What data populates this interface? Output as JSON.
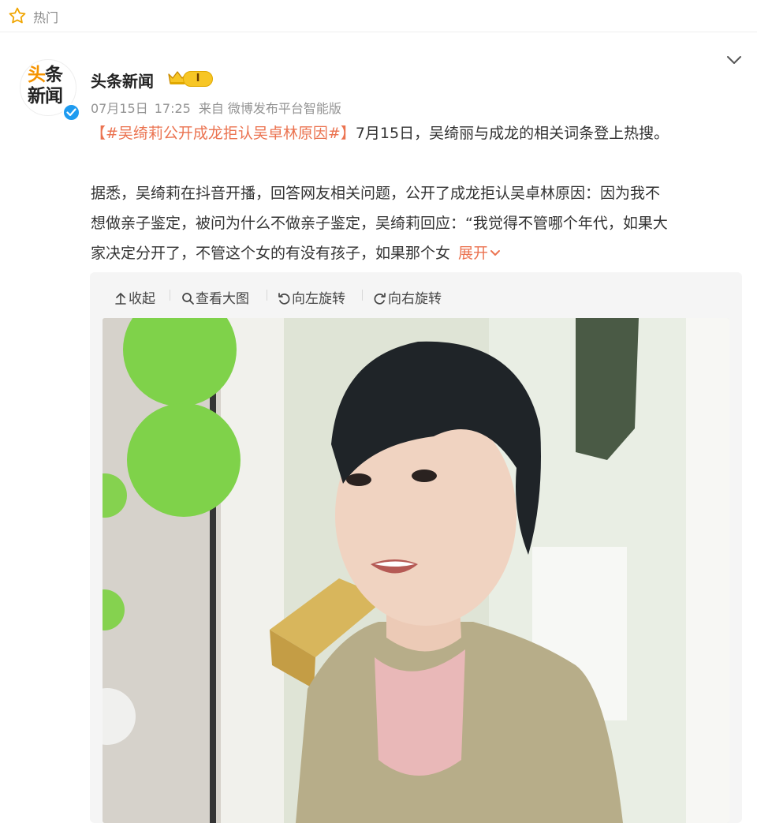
{
  "topbar": {
    "label": "热门",
    "icon": "star-icon"
  },
  "post": {
    "author": "头条新闻",
    "avatar_line1": [
      "头",
      "条"
    ],
    "avatar_line2": "新闻",
    "level": "I",
    "date": "07月15日",
    "time": "17:25",
    "source": "来自 微博发布平台智能版",
    "hashtag": "【#吴绮莉公开成龙拒认吴卓林原因#】",
    "intro": "7月15日，吴绮丽与成龙的相关词条登上热搜。",
    "body_lines": [
      "据悉，吴绮莉在抖音开播，回答网友相关问题，公开了成龙拒认吴卓林原因：因为我不",
      "想做亲子鉴定，被问为什么不做亲子鉴定，吴绮莉回应：“我觉得不管哪个年代，如果大",
      "家决定分开了，不管这个女的有没有孩子，如果那个女"
    ],
    "expand_label": "展开"
  },
  "image_toolbar": {
    "collapse": "收起",
    "view_large": "查看大图",
    "rotate_left": "向左旋转",
    "rotate_right": "向右旋转"
  },
  "colors": {
    "link_orange": "#eb7350",
    "verified_blue": "#1e9bf0",
    "level_gold": "#f7c625",
    "meta_gray": "#939393"
  }
}
